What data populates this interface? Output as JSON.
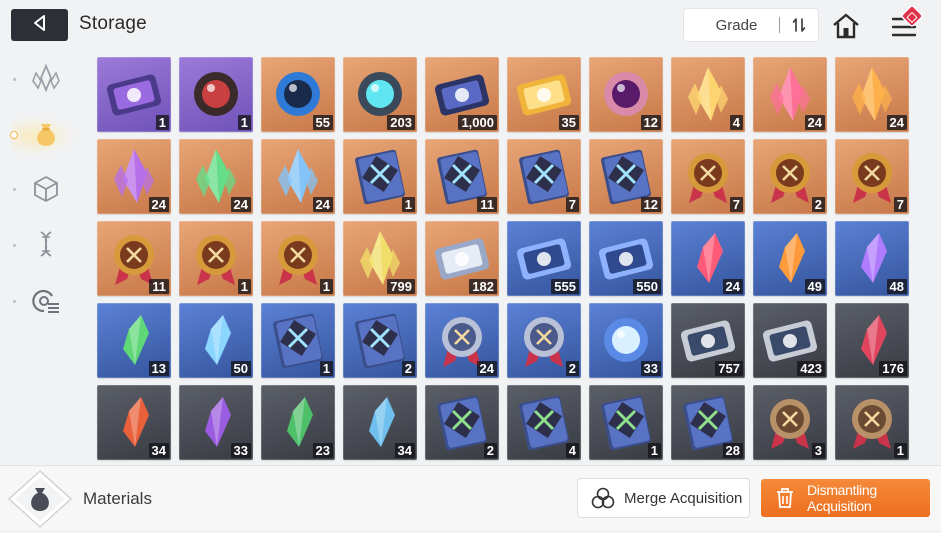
{
  "header": {
    "title": "Storage",
    "sort_label": "Grade",
    "icons": [
      "back-arrow-icon",
      "sort-icon",
      "home-icon",
      "menu-icon"
    ]
  },
  "sidebar": {
    "items": [
      {
        "icon": "crystal-icon",
        "active": false
      },
      {
        "icon": "material-bag-icon",
        "active": true
      },
      {
        "icon": "cube-icon",
        "active": false
      },
      {
        "icon": "dna-icon",
        "active": false
      },
      {
        "icon": "radar-list-icon",
        "active": false
      }
    ]
  },
  "inventory": {
    "rows": [
      [
        {
          "icon": "purple-eye-card",
          "grade": "purple",
          "qty": "1"
        },
        {
          "icon": "red-demon-mask",
          "grade": "purple",
          "qty": "1"
        },
        {
          "icon": "blue-tentacle-orb",
          "grade": "orange",
          "qty": "55"
        },
        {
          "icon": "cyan-energy-sphere",
          "grade": "orange",
          "qty": "203"
        },
        {
          "icon": "star-chip-case",
          "grade": "orange",
          "qty": "1,000"
        },
        {
          "icon": "gold-compass-ticket",
          "grade": "orange",
          "qty": "35"
        },
        {
          "icon": "purple-eye-brain",
          "grade": "orange",
          "qty": "12"
        },
        {
          "icon": "gold-feather-sparkle",
          "grade": "orange",
          "qty": "4"
        },
        {
          "icon": "pink-crystal",
          "grade": "orange",
          "qty": "24"
        },
        {
          "icon": "orange-crystal",
          "grade": "orange",
          "qty": "24"
        }
      ],
      [
        {
          "icon": "purple-crystal",
          "grade": "orange",
          "qty": "24"
        },
        {
          "icon": "green-crystal",
          "grade": "orange",
          "qty": "24"
        },
        {
          "icon": "blue-crystal",
          "grade": "orange",
          "qty": "24"
        },
        {
          "icon": "sword-skill-book",
          "grade": "orange",
          "qty": "1"
        },
        {
          "icon": "eye-skill-book",
          "grade": "orange",
          "qty": "11"
        },
        {
          "icon": "slash-skill-book",
          "grade": "orange",
          "qty": "7"
        },
        {
          "icon": "globe-skill-book",
          "grade": "orange",
          "qty": "12"
        },
        {
          "icon": "sword-medal",
          "grade": "orange",
          "qty": "7"
        },
        {
          "icon": "shield-medal",
          "grade": "orange",
          "qty": "2"
        },
        {
          "icon": "target-medal",
          "grade": "orange",
          "qty": "7"
        }
      ],
      [
        {
          "icon": "cross-swords-medal",
          "grade": "orange",
          "qty": "11"
        },
        {
          "icon": "compass-medal",
          "grade": "orange",
          "qty": "1"
        },
        {
          "icon": "globe-medal",
          "grade": "orange",
          "qty": "1"
        },
        {
          "icon": "gold-crystal-burst",
          "grade": "orange",
          "qty": "799"
        },
        {
          "icon": "music-note-scroll",
          "grade": "orange",
          "qty": "182"
        },
        {
          "icon": "portrait-ticket",
          "grade": "blue",
          "qty": "555"
        },
        {
          "icon": "compass-ticket",
          "grade": "blue",
          "qty": "550"
        },
        {
          "icon": "red-shard",
          "grade": "blue",
          "qty": "24"
        },
        {
          "icon": "amber-shard",
          "grade": "blue",
          "qty": "49"
        },
        {
          "icon": "violet-shard",
          "grade": "blue",
          "qty": "48"
        }
      ],
      [
        {
          "icon": "green-shard",
          "grade": "blue",
          "qty": "13"
        },
        {
          "icon": "ice-shard",
          "grade": "blue",
          "qty": "50"
        },
        {
          "icon": "sword-manual",
          "grade": "blue",
          "qty": "1"
        },
        {
          "icon": "blade-manual",
          "grade": "blue",
          "qty": "2"
        },
        {
          "icon": "slash-silver-medal",
          "grade": "blue",
          "qty": "24"
        },
        {
          "icon": "compass-silver-medal",
          "grade": "blue",
          "qty": "2"
        },
        {
          "icon": "frost-orb",
          "grade": "blue",
          "qty": "33"
        },
        {
          "icon": "portrait-pass",
          "grade": "dark",
          "qty": "757"
        },
        {
          "icon": "compass-pass",
          "grade": "dark",
          "qty": "423"
        },
        {
          "icon": "crimson-shard",
          "grade": "dark",
          "qty": "176"
        }
      ],
      [
        {
          "icon": "ember-shard",
          "grade": "dark",
          "qty": "34"
        },
        {
          "icon": "amethyst-shard",
          "grade": "dark",
          "qty": "33"
        },
        {
          "icon": "jade-shard",
          "grade": "dark",
          "qty": "23"
        },
        {
          "icon": "aqua-shard",
          "grade": "dark",
          "qty": "34"
        },
        {
          "icon": "sword-tome",
          "grade": "dark",
          "qty": "2"
        },
        {
          "icon": "eye-tome",
          "grade": "dark",
          "qty": "4"
        },
        {
          "icon": "wing-tome",
          "grade": "dark",
          "qty": "1"
        },
        {
          "icon": "globe-tome",
          "grade": "dark",
          "qty": "28"
        },
        {
          "icon": "sword-bronze-medal",
          "grade": "dark",
          "qty": "3"
        },
        {
          "icon": "shield-bronze-medal",
          "grade": "dark",
          "qty": "1"
        }
      ]
    ]
  },
  "footer": {
    "category_label": "Materials",
    "category_icon": "material-bag-icon",
    "merge_label": "Merge Acquisition",
    "dismantle_label": "Dismantling Acquisition"
  },
  "colors": {
    "accent": "#ec6f1e",
    "grade_purple": "#7b5cc4",
    "grade_orange": "#d78a59",
    "grade_blue": "#4467b5",
    "grade_dark": "#474a52",
    "badge": "#e0324b"
  }
}
